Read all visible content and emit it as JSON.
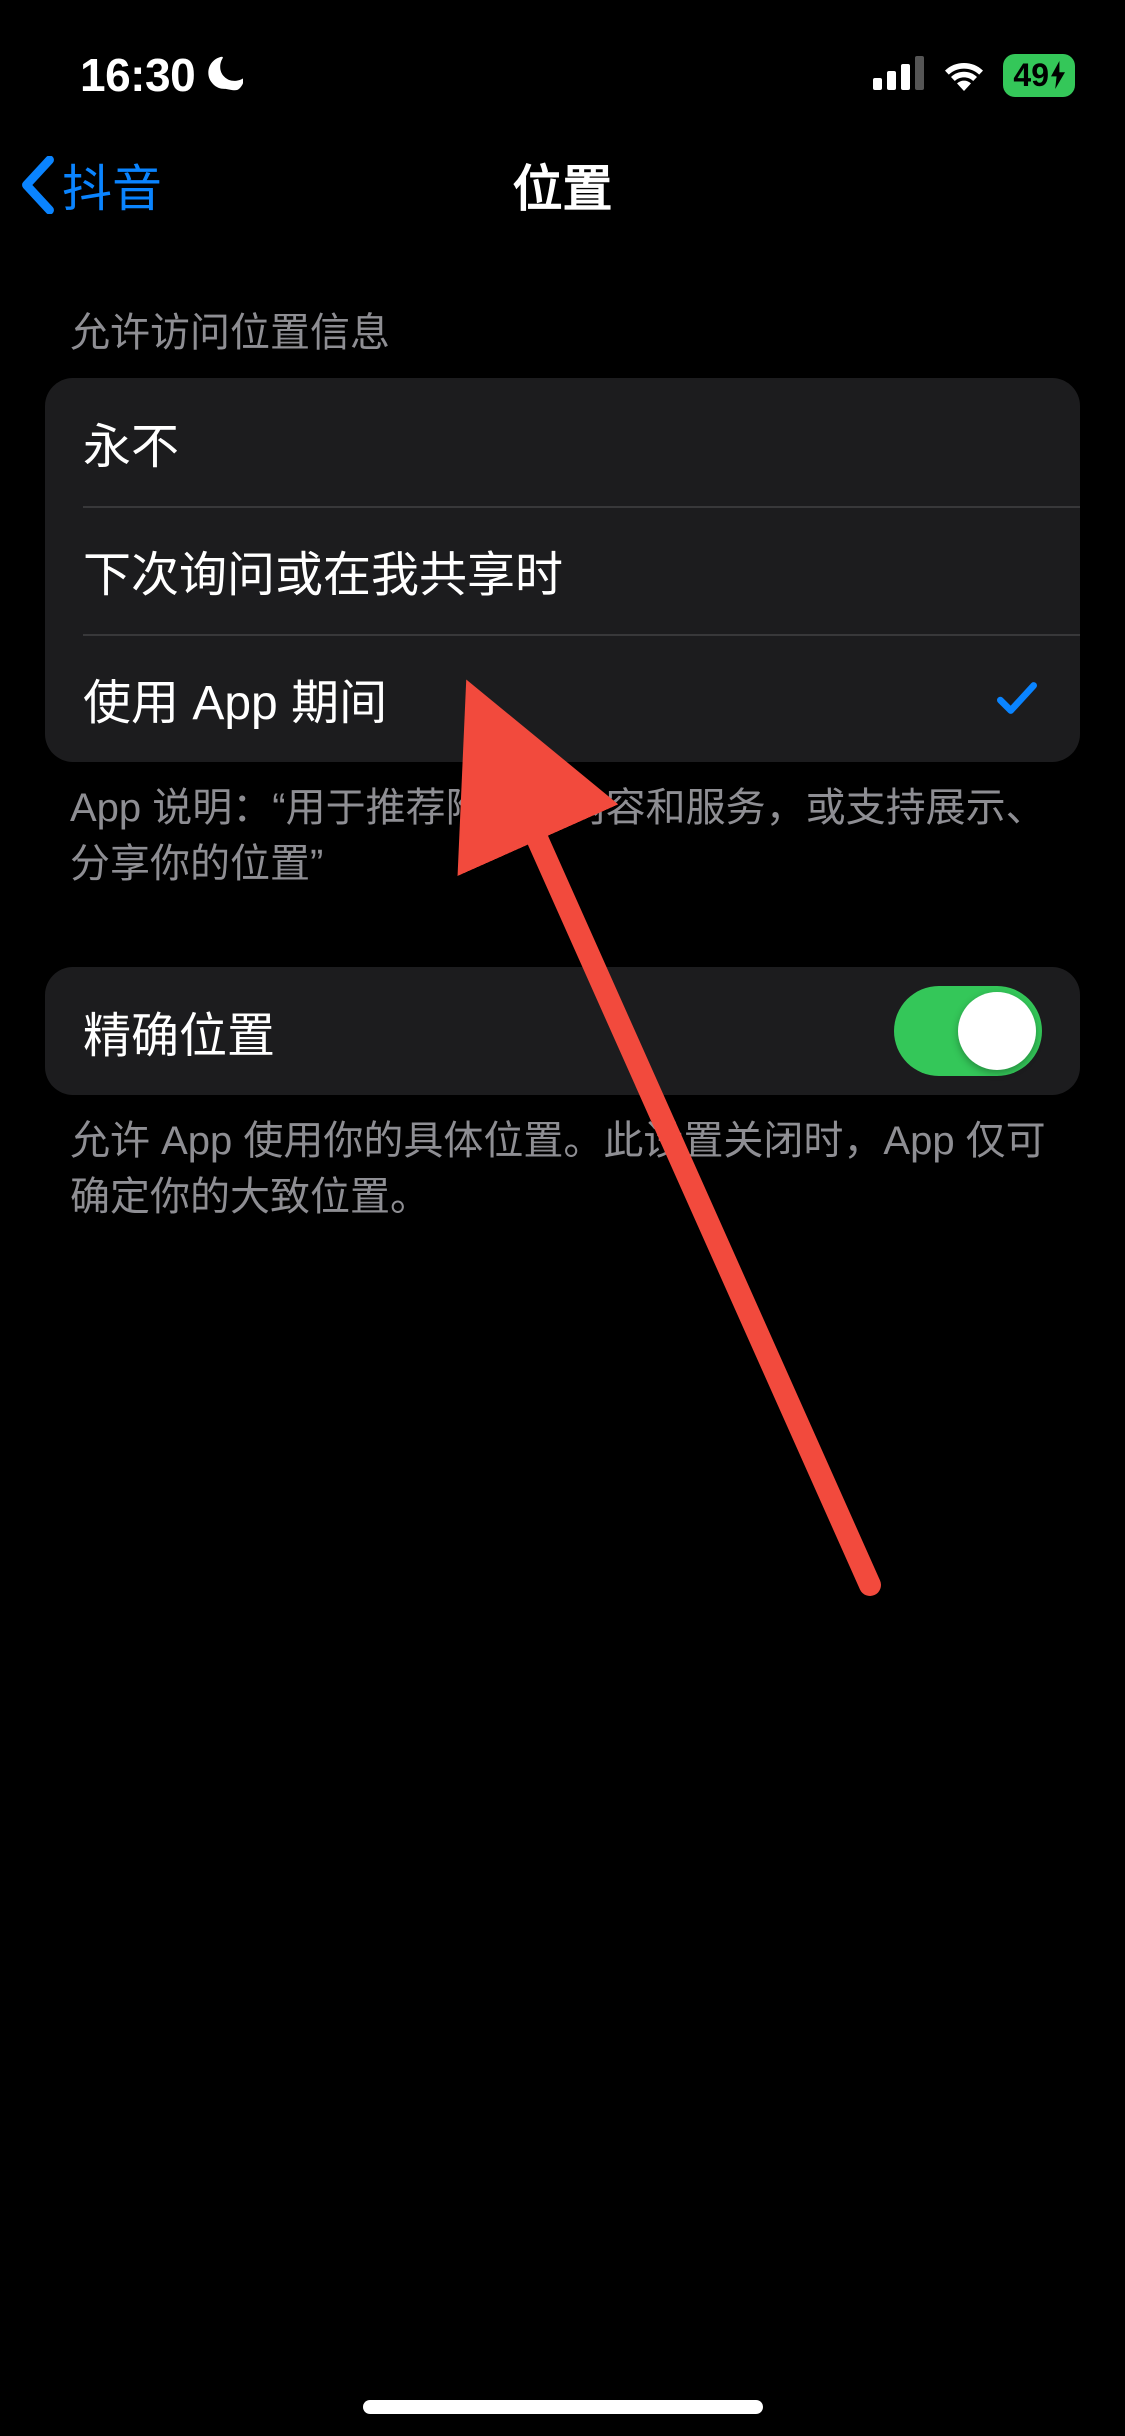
{
  "status": {
    "time": "16:30",
    "battery_percent": "49"
  },
  "nav": {
    "back_label": "抖音",
    "title": "位置"
  },
  "sections": {
    "location_access": {
      "header": "允许访问位置信息",
      "options": [
        {
          "label": "永不",
          "selected": false
        },
        {
          "label": "下次询问或在我共享时",
          "selected": false
        },
        {
          "label": "使用 App 期间",
          "selected": true
        }
      ],
      "footer": "App 说明：“用于推荐附近的内容和服务，或支持展示、分享你的位置”"
    },
    "precise": {
      "label": "精确位置",
      "enabled": true,
      "footer": "允许 App 使用你的具体位置。此设置关闭时，App 仅可确定你的大致位置。"
    }
  }
}
